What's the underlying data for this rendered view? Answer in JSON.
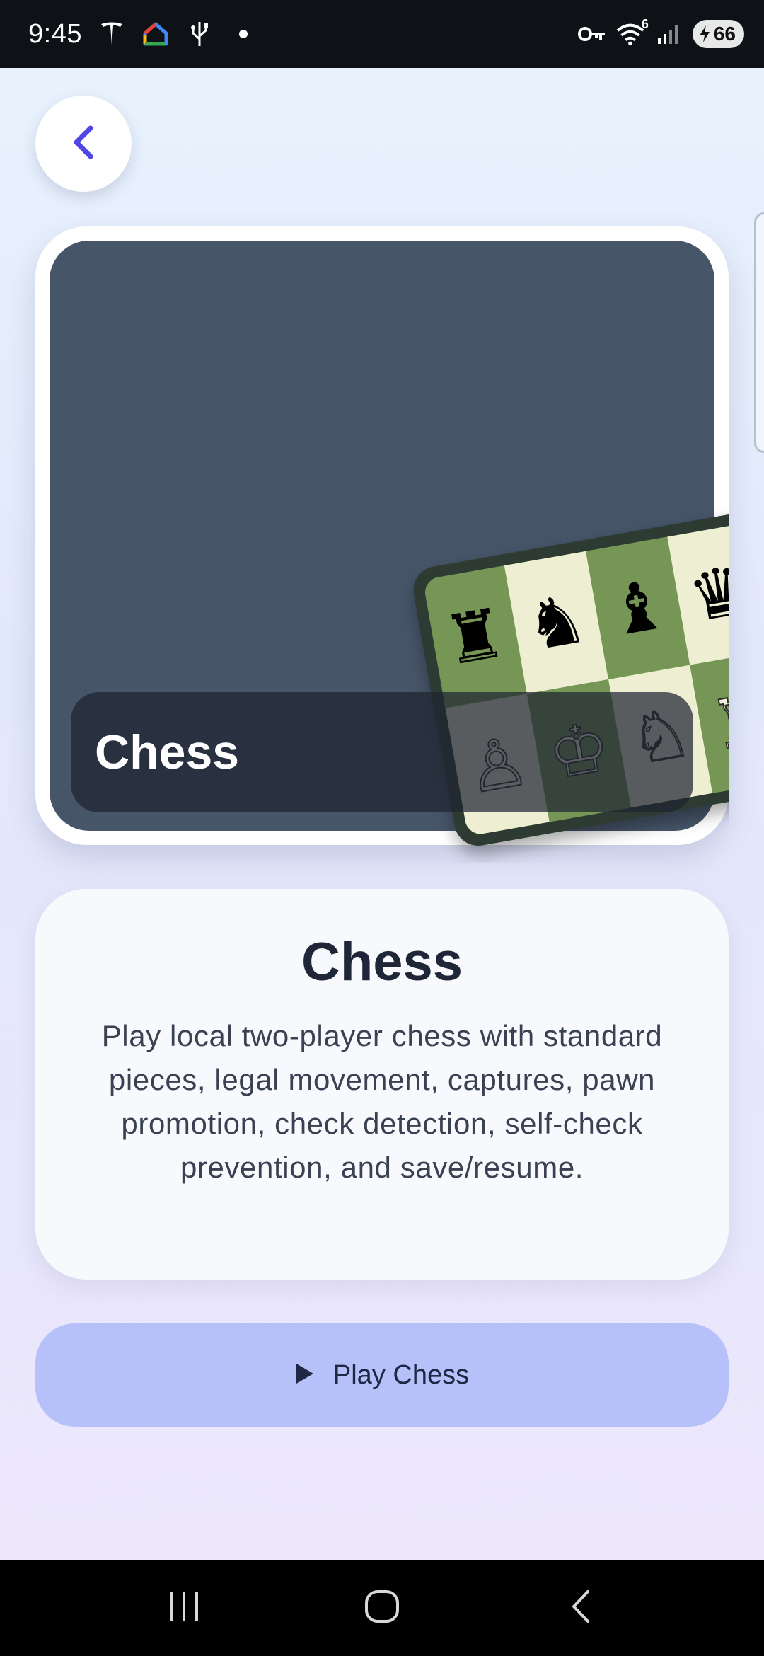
{
  "status_bar": {
    "time": "9:45",
    "battery": "66",
    "wifi_badge": "6",
    "left_icons": [
      "tesla-icon",
      "google-home-icon",
      "usb-icon",
      "dot-icon"
    ],
    "right_icons": [
      "vpn-key-icon",
      "wifi-icon",
      "signal-icon",
      "battery-icon"
    ]
  },
  "header": {
    "back_icon": "chevron-left-icon",
    "accent": "#4f46e5"
  },
  "hero": {
    "title": "Chess",
    "background": "#475569",
    "board": {
      "rows": [
        [
          "♜",
          "♞",
          "♝",
          "♛"
        ],
        [
          "♙",
          "♔",
          "♘",
          "♖"
        ]
      ]
    }
  },
  "info": {
    "title": "Chess",
    "description": "Play local two-player chess with standard pieces, legal movement, captures, pawn promotion, check detection, self-check prevention, and save/resume."
  },
  "play_button": {
    "label": "Play Chess",
    "icon": "play-icon",
    "color": "#b6c1fa"
  },
  "nav_bar": {
    "icons": [
      "recents-icon",
      "home-icon",
      "back-icon"
    ]
  }
}
